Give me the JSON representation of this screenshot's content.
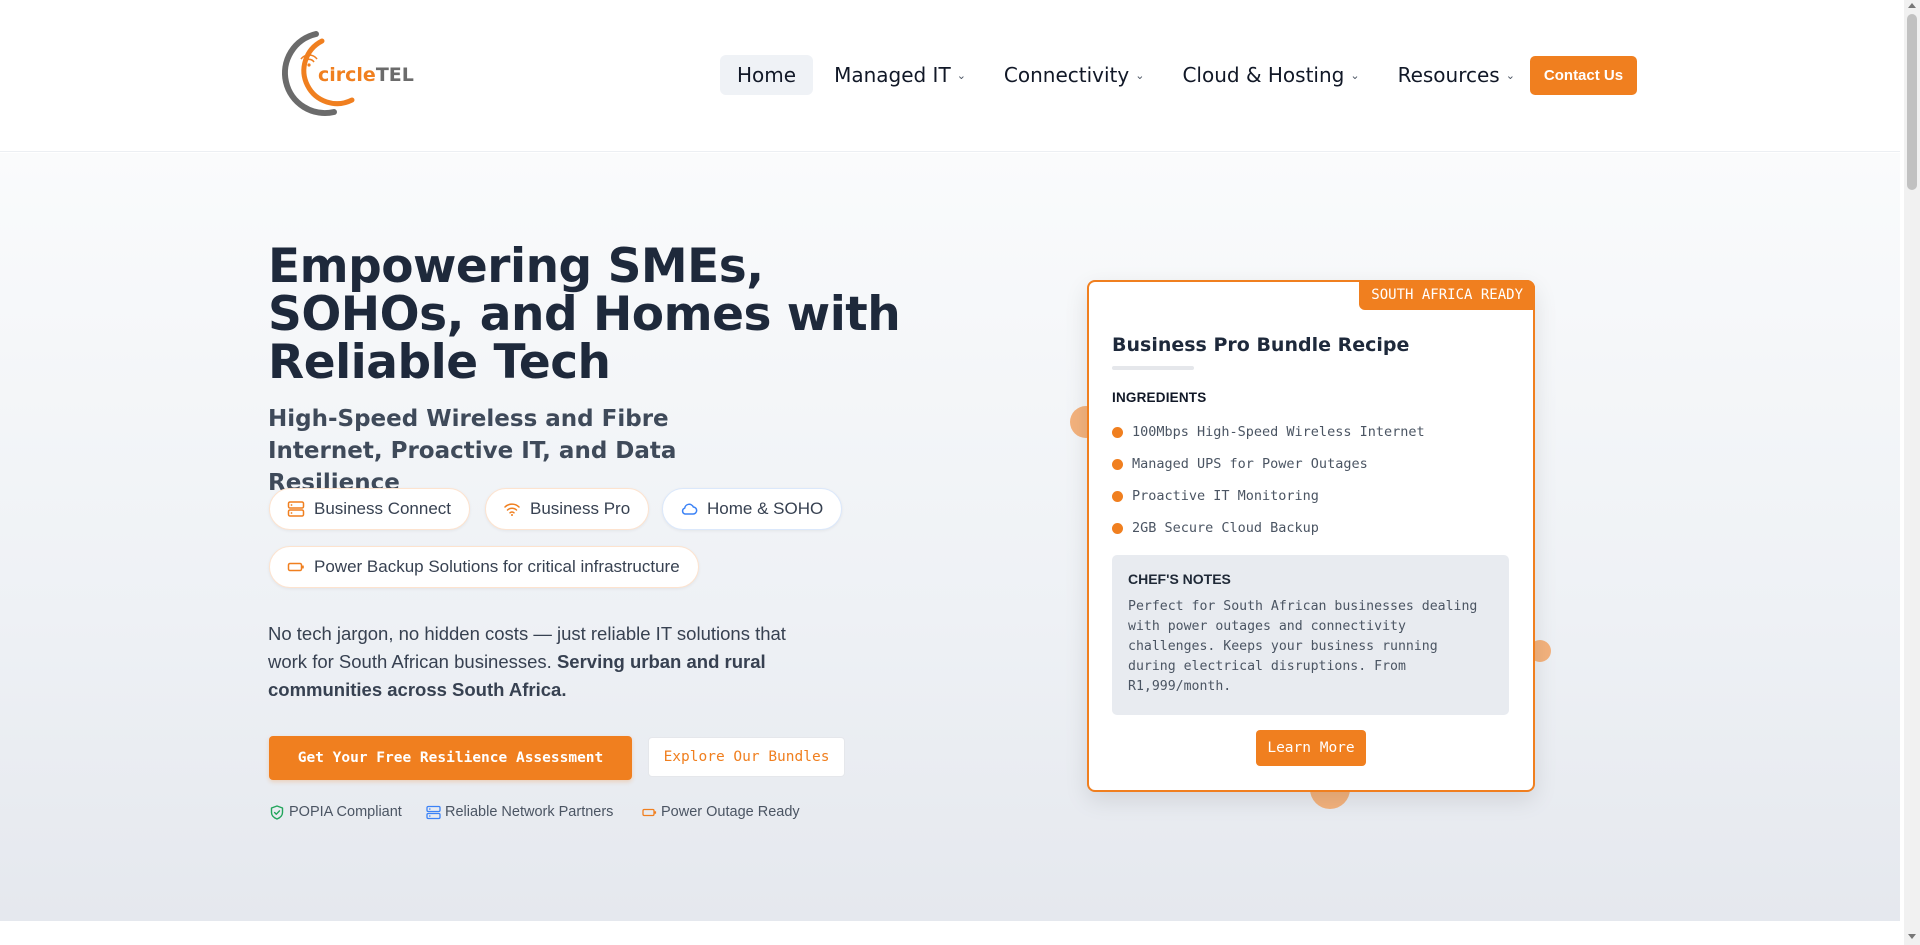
{
  "header": {
    "logo_text_a": "circle",
    "logo_text_b": "TEL",
    "nav": [
      {
        "label": "Home",
        "chevron": ""
      },
      {
        "label": "Managed IT",
        "chevron": "⌄"
      },
      {
        "label": "Connectivity",
        "chevron": "⌄"
      },
      {
        "label": "Cloud & Hosting",
        "chevron": "⌄"
      },
      {
        "label": "Resources",
        "chevron": "⌄"
      }
    ],
    "contact_label": "Contact Us"
  },
  "hero": {
    "headline": "Empowering SMEs, SOHOs, and Homes with Reliable Tech",
    "subhead": "High-Speed Wireless and Fibre Internet, Proactive IT, and Data Resilience",
    "chips": [
      {
        "label": "Business Connect",
        "icon": "server-icon"
      },
      {
        "label": "Business Pro",
        "icon": "wifi-icon"
      },
      {
        "label": "Home & SOHO",
        "icon": "cloud-icon"
      },
      {
        "label": "Power Backup Solutions for critical infrastructure",
        "icon": "battery-icon"
      }
    ],
    "body_text": "No tech jargon, no hidden costs — just reliable IT solutions that work for South African businesses. ",
    "body_bold": "Serving urban and rural communities across South Africa.",
    "cta_primary": "Get Your Free Resilience Assessment",
    "cta_secondary": "Explore Our Bundles",
    "trust": [
      {
        "label": "POPIA Compliant",
        "icon": "shield-check-icon"
      },
      {
        "label": "Reliable Network Partners",
        "icon": "server-icon"
      },
      {
        "label": "Power Outage Ready",
        "icon": "battery-icon"
      }
    ]
  },
  "card": {
    "badge": "SOUTH AFRICA READY",
    "title": "Business Pro Bundle Recipe",
    "ingredients_title": "INGREDIENTS",
    "ingredients": [
      "100Mbps High-Speed Wireless Internet",
      "Managed UPS for Power Outages",
      "Proactive IT Monitoring",
      "2GB Secure Cloud Backup"
    ],
    "notes_title": "CHEF'S NOTES",
    "notes_text": "Perfect for South African businesses dealing with power outages and connectivity challenges. Keeps your business running during electrical disruptions. From R1,999/month.",
    "learn_more": "Learn More"
  },
  "colors": {
    "brand_orange": "#f07f1f",
    "heading": "#1e293b",
    "text": "#374151"
  }
}
